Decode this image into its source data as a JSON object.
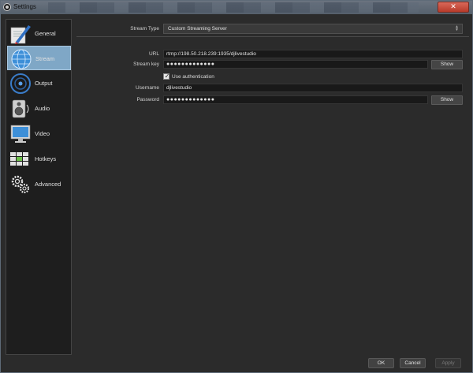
{
  "window": {
    "title": "Settings",
    "close_glyph": "✕"
  },
  "sidebar": {
    "items": [
      {
        "label": "General",
        "icon": "general-icon",
        "active": false
      },
      {
        "label": "Stream",
        "icon": "stream-globe-icon",
        "active": true
      },
      {
        "label": "Output",
        "icon": "output-icon",
        "active": false
      },
      {
        "label": "Audio",
        "icon": "speaker-icon",
        "active": false
      },
      {
        "label": "Video",
        "icon": "monitor-icon",
        "active": false
      },
      {
        "label": "Hotkeys",
        "icon": "keyboard-icon",
        "active": false
      },
      {
        "label": "Advanced",
        "icon": "gears-icon",
        "active": false
      }
    ]
  },
  "stream": {
    "stream_type_label": "Stream Type",
    "stream_type_value": "Custom Streaming Server",
    "url_label": "URL",
    "url_value": "rtmp://198.50.218.239:1935/djlivestudio",
    "stream_key_label": "Stream key",
    "stream_key_value": "●●●●●●●●●●●●●",
    "show_label": "Show",
    "use_auth_label": "Use authentication",
    "use_auth_checked": true,
    "username_label": "Username",
    "username_value": "djlivestudio",
    "password_label": "Password",
    "password_value": "●●●●●●●●●●●●●"
  },
  "footer": {
    "ok": "OK",
    "cancel": "Cancel",
    "apply": "Apply"
  }
}
